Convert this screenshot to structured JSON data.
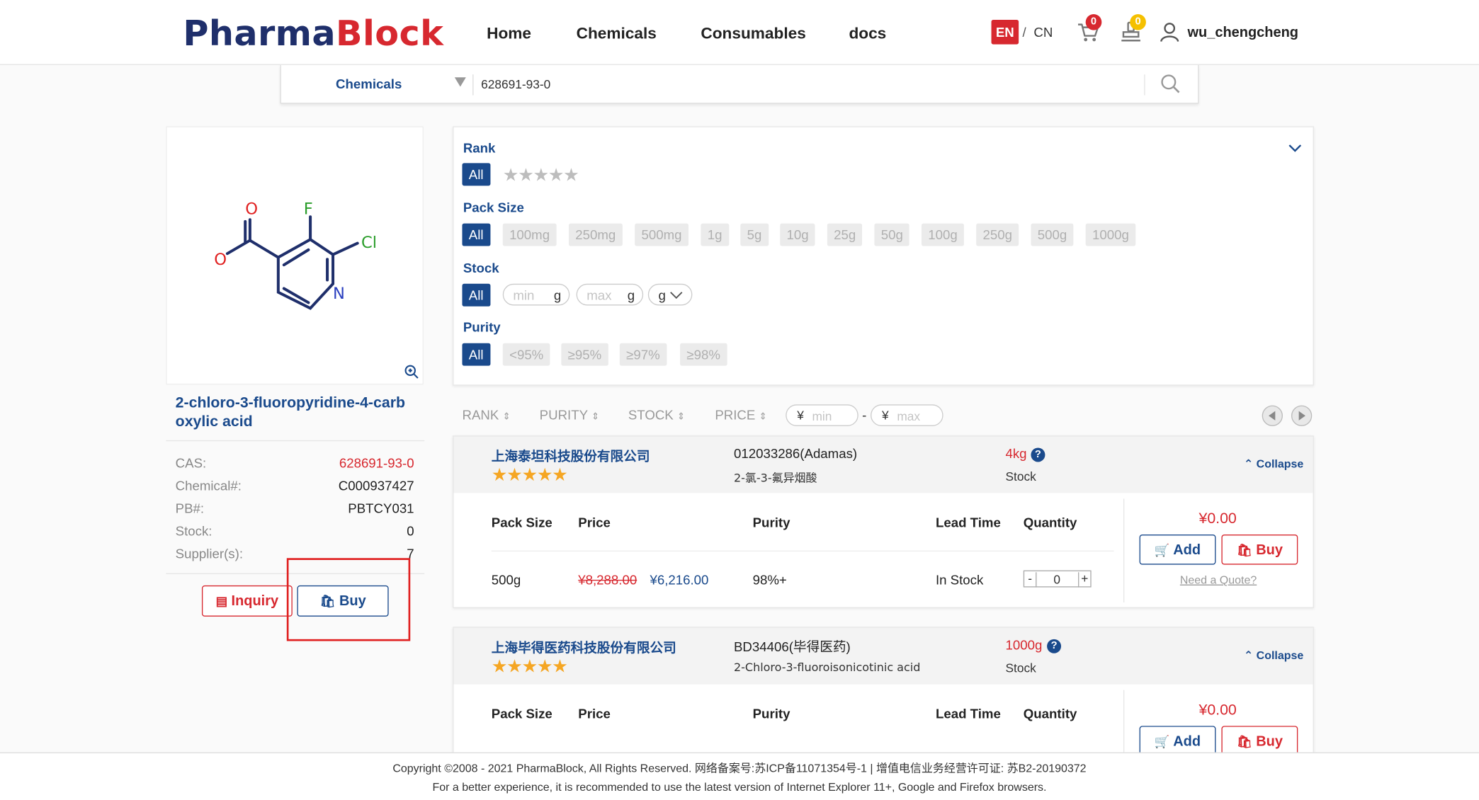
{
  "header": {
    "logo_part1": "Pharma",
    "logo_part2": "Block",
    "nav": [
      "Home",
      "Chemicals",
      "Consumables",
      "docs"
    ],
    "lang_en": "EN",
    "lang_sep": "/",
    "lang_cn": "CN",
    "cart_count": "0",
    "quote_count": "0",
    "username": "wu_chengcheng"
  },
  "search": {
    "category": "Chemicals",
    "value": "628691-93-0"
  },
  "product": {
    "title": "2-chloro-3-fluoropyridine-4-carb oxylic acid",
    "structure_atoms": [
      "O",
      "F",
      "Cl",
      "O",
      "N"
    ],
    "info": [
      {
        "label": "CAS:",
        "value": "628691-93-0",
        "accent": true
      },
      {
        "label": "Chemical#:",
        "value": "C000937427",
        "accent": false
      },
      {
        "label": "PB#:",
        "value": "PBTCY031",
        "accent": false
      },
      {
        "label": "Stock:",
        "value": "0",
        "accent": false
      },
      {
        "label": "Supplier(s):",
        "value": "7",
        "accent": false
      }
    ],
    "inquiry_label": "Inquiry",
    "buy_label": "Buy"
  },
  "filters": {
    "rank_title": "Rank",
    "all_label": "All",
    "pack_title": "Pack Size",
    "pack_sizes": [
      "100mg",
      "250mg",
      "500mg",
      "1g",
      "5g",
      "10g",
      "25g",
      "50g",
      "100g",
      "250g",
      "500g",
      "1000g"
    ],
    "stock_title": "Stock",
    "stock_min_placeholder": "min",
    "stock_max_placeholder": "max",
    "stock_unit": "g",
    "purity_title": "Purity",
    "purities": [
      "<95%",
      "≥95%",
      "≥97%",
      "≥98%"
    ]
  },
  "sort": {
    "items": [
      "RANK",
      "PURITY",
      "STOCK",
      "PRICE"
    ],
    "currency": "¥",
    "min_placeholder": "min",
    "max_placeholder": "max",
    "range_sep": "-"
  },
  "suppliers": [
    {
      "name": "上海泰坦科技股份有限公司",
      "rating": 5,
      "code": "012033286(Adamas)",
      "alias": "2-氯-3-氟异烟酸",
      "qty": "4kg",
      "stock_label": "Stock",
      "collapse_label": "Collapse",
      "columns": [
        "Pack Size",
        "Price",
        "Purity",
        "Lead Time",
        "Quantity"
      ],
      "rows": [
        {
          "pack": "500g",
          "old_price": "¥8,288.00",
          "price": "¥6,216.00",
          "purity": "98%+",
          "lead": "In Stock",
          "qty": "0"
        }
      ],
      "total": "¥0.00",
      "add_label": "Add",
      "buy_label": "Buy",
      "quote_label": "Need a Quote?"
    },
    {
      "name": "上海毕得医药科技股份有限公司",
      "rating": 5,
      "code": "BD34406(毕得医药)",
      "alias": "2-Chloro-3-fluoroisonicotinic acid",
      "qty": "1000g",
      "stock_label": "Stock",
      "collapse_label": "Collapse",
      "columns": [
        "Pack Size",
        "Price",
        "Purity",
        "Lead Time",
        "Quantity"
      ],
      "rows": [],
      "total": "¥0.00",
      "add_label": "Add",
      "buy_label": "Buy"
    }
  ],
  "footer": {
    "line1": "Copyright ©2008 - 2021 PharmaBlock, All Rights Reserved. 网络备案号:苏ICP备11071354号-1 | 增值电信业务经营许可证: 苏B2-20190372",
    "line2": "For a better experience, it is recommended to use the latest version of Internet Explorer 11+, Google and Firefox browsers."
  },
  "colors": {
    "brand_blue": "#1a4a8c",
    "brand_red": "#d7282f",
    "star_gold": "#f5a623"
  }
}
